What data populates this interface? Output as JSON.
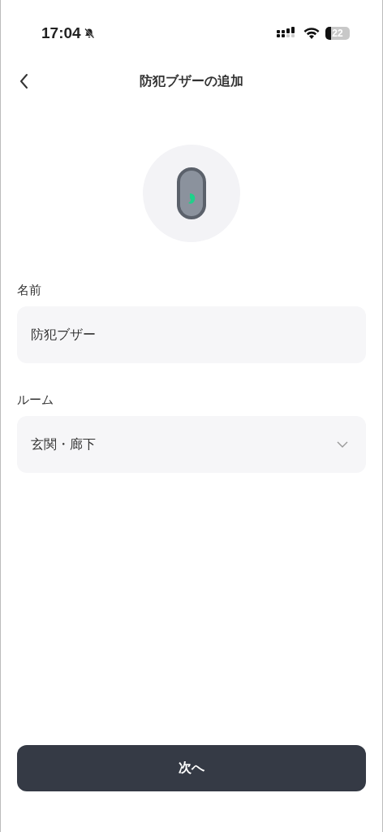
{
  "status_bar": {
    "time": "17:04",
    "battery": "22"
  },
  "header": {
    "title": "防犯ブザーの追加"
  },
  "form": {
    "fields": [
      {
        "label": "名前",
        "value": "防犯ブザー",
        "kind": "text"
      },
      {
        "label": "ルーム",
        "value": "玄関・廊下",
        "kind": "select"
      }
    ]
  },
  "primary_button": "次へ"
}
